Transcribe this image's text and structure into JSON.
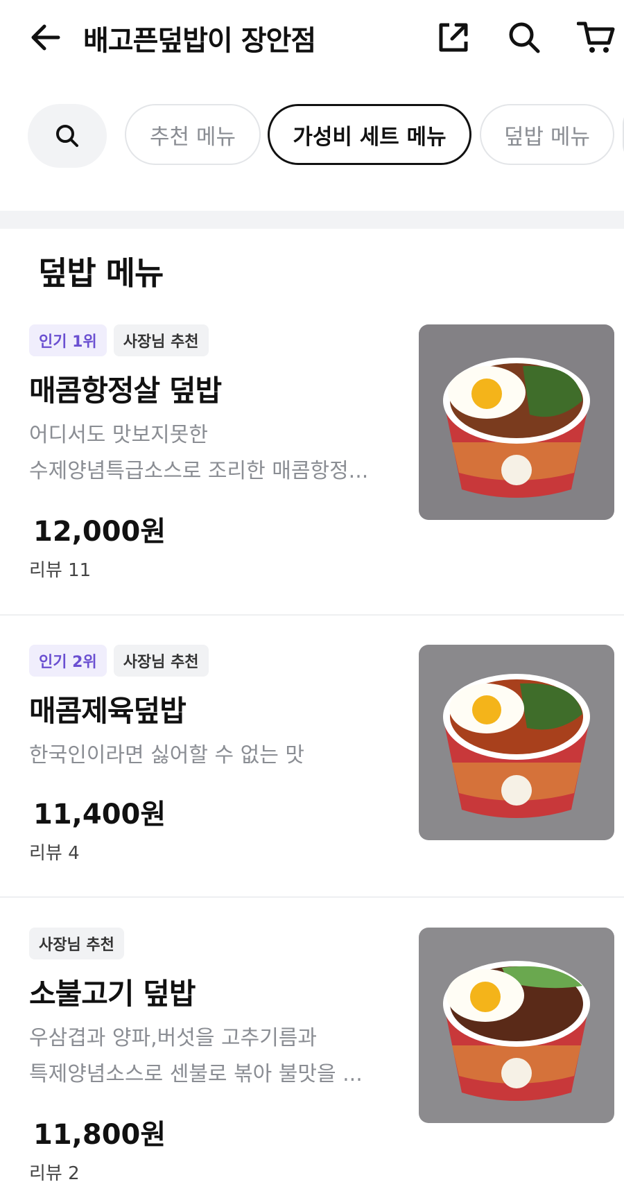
{
  "header": {
    "title": "배고픈덮밥이 장안점",
    "icons": [
      "back-arrow-icon",
      "share-icon",
      "search-icon",
      "cart-icon"
    ]
  },
  "tabs": {
    "search_icon": "search-icon",
    "items": [
      {
        "label": "추천 메뉴",
        "active": false
      },
      {
        "label": "가성비 세트 메뉴",
        "active": true
      },
      {
        "label": "덮밥 메뉴",
        "active": false
      }
    ]
  },
  "section": {
    "title": "덮밥 메뉴"
  },
  "menu": [
    {
      "badges": [
        "인기 1위",
        "사장님 추천"
      ],
      "name": "매콤항정살 덮밥",
      "desc": [
        "어디서도 맛보지못한",
        "수제양념특급소스로 조리한 매콤항정..."
      ],
      "price": "12,000원",
      "reviews": "리뷰 11"
    },
    {
      "badges": [
        "인기 2위",
        "사장님 추천"
      ],
      "name": "매콤제육덮밥",
      "desc": [
        "한국인이라면 싫어할 수 없는 맛"
      ],
      "price": "11,400원",
      "reviews": "리뷰 4"
    },
    {
      "badges": [
        "사장님 추천"
      ],
      "name": "소불고기 덮밥",
      "desc": [
        "우삼겹과 양파,버섯을 고추기름과",
        "특제양념소스로 센불로 볶아 불맛을 ..."
      ],
      "price": "11,800원",
      "reviews": "리뷰 2"
    }
  ],
  "colors": {
    "accent_rank": "#6a4fd1",
    "band": "#f2f3f5"
  }
}
